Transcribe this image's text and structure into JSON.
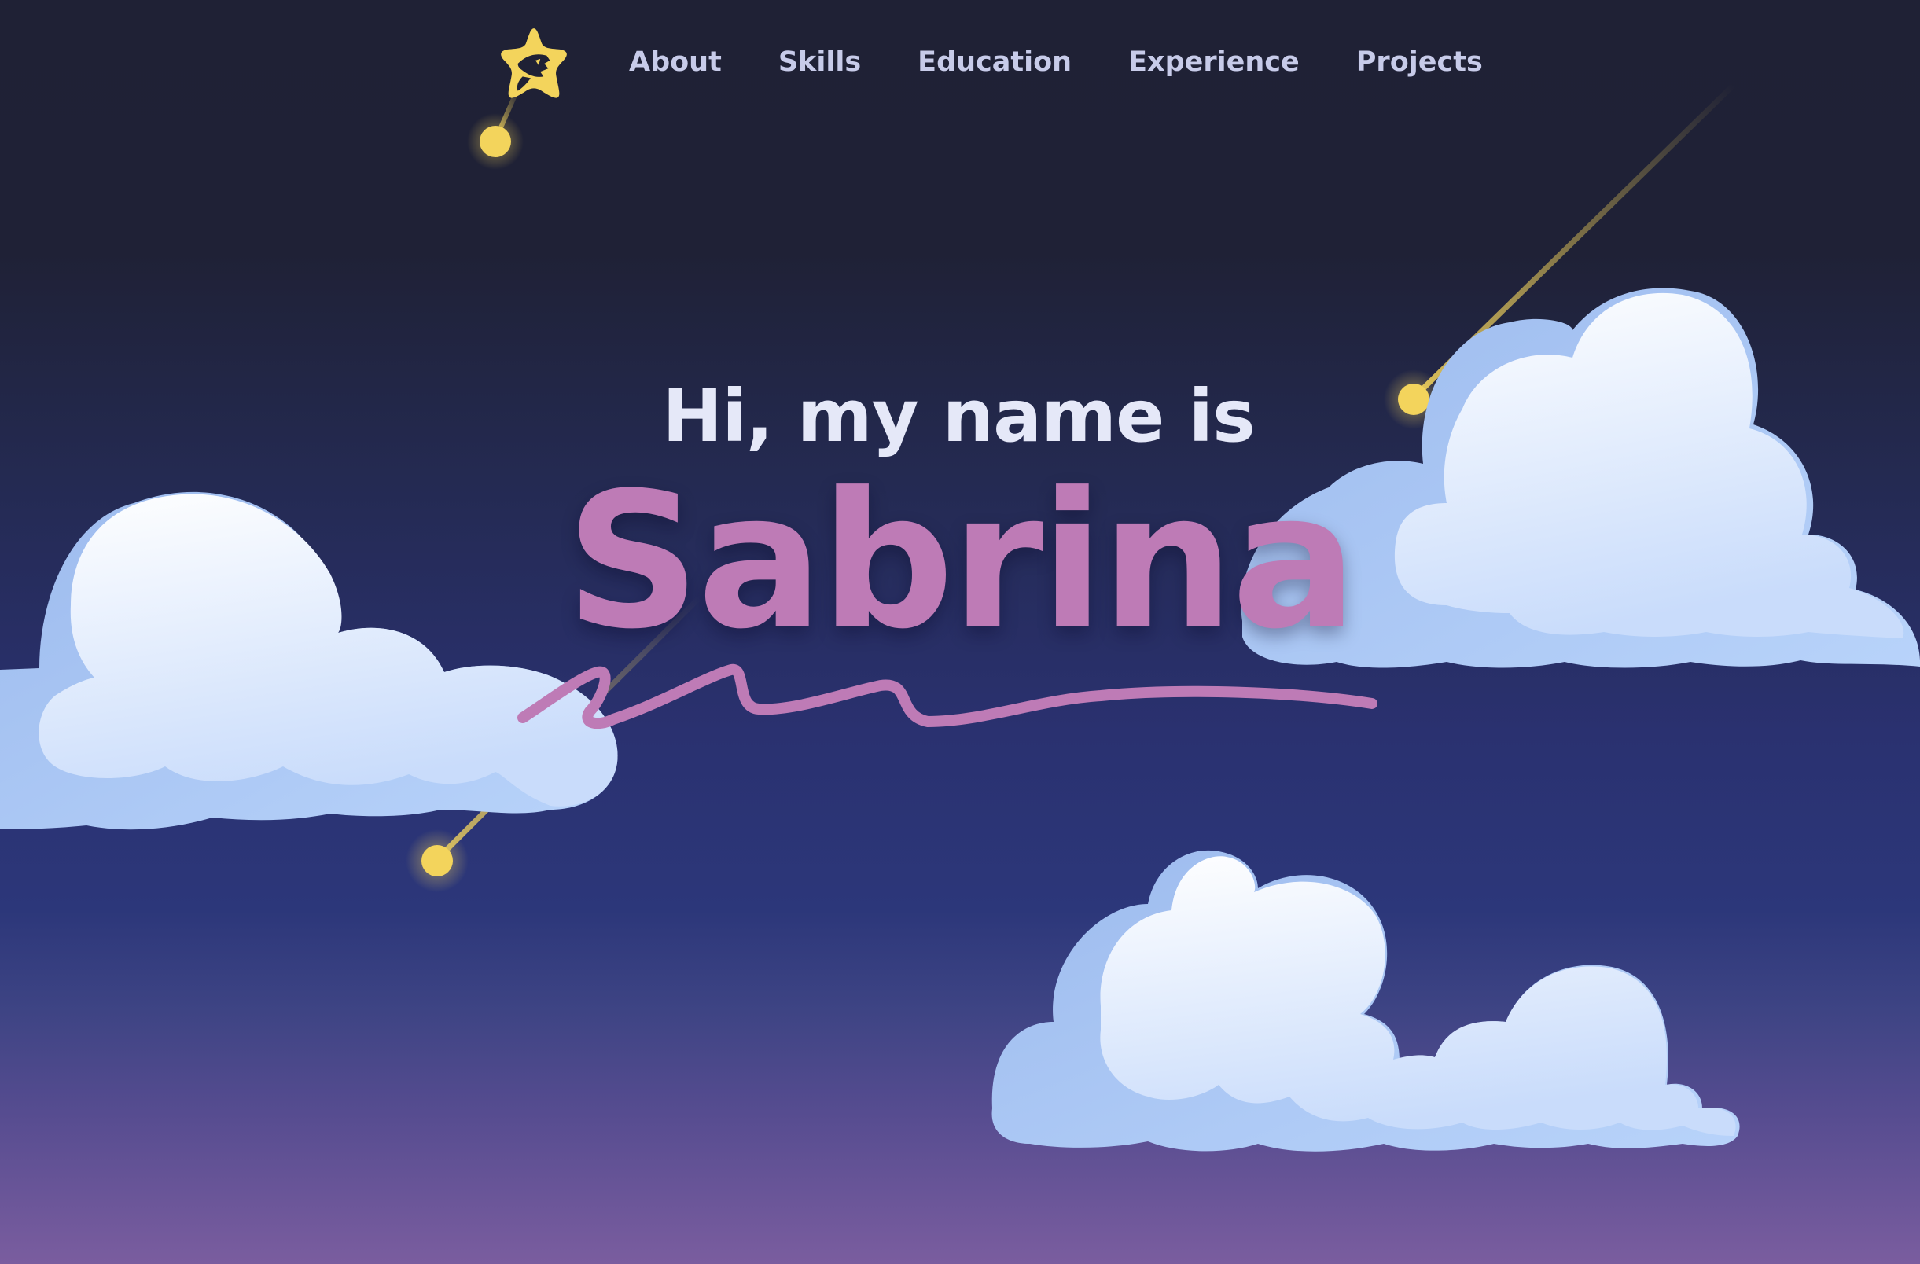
{
  "nav": {
    "logo_icon": "star-logo-icon",
    "links": [
      {
        "label": "About"
      },
      {
        "label": "Skills"
      },
      {
        "label": "Education"
      },
      {
        "label": "Experience"
      },
      {
        "label": "Projects"
      }
    ]
  },
  "hero": {
    "greeting": "Hi, my name is",
    "name": "Sabrina"
  },
  "colors": {
    "accent_name": "#be7bb6",
    "nav_text": "#c7cbe9",
    "greeting_text": "#e5e8f8",
    "star_yellow": "#f3d45c",
    "cloud_light": "#f4f8ff",
    "cloud_shadow": "#a9c8f2",
    "background_top": "#1f2135",
    "background_bottom": "#7a5d9f"
  }
}
